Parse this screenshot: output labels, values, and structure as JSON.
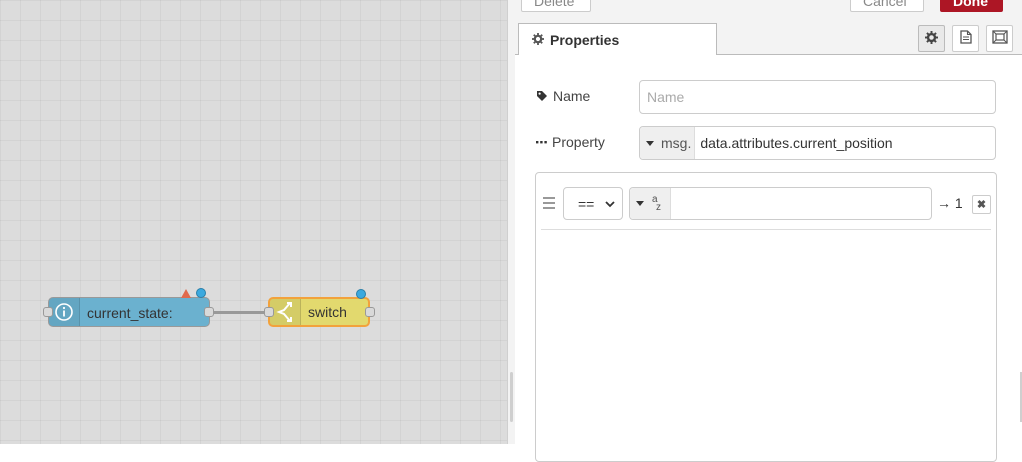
{
  "canvas": {
    "nodes": [
      {
        "label": "current_state:",
        "icon": "info-icon",
        "color": "#6bb1cf"
      },
      {
        "label": "switch",
        "icon": "switch-icon",
        "color": "#e2d96e"
      }
    ]
  },
  "tray": {
    "buttons": {
      "delete": "Delete",
      "cancel": "Cancel",
      "done": "Done"
    },
    "tab_label": "Properties",
    "name": {
      "label": "Name",
      "placeholder": "Name",
      "value": ""
    },
    "property": {
      "label": "Property",
      "type": "msg.",
      "value": "data.attributes.current_position"
    },
    "rules": [
      {
        "operator": "==",
        "value_type_icon": "az-icon",
        "value": "",
        "output": "→ 1"
      }
    ]
  },
  "colors": {
    "accent": "#ad1625",
    "info_node": "#6bb1cf",
    "switch_node": "#e2d96e",
    "warning": "#e06a4d",
    "changed_dot": "#3ba9df"
  }
}
